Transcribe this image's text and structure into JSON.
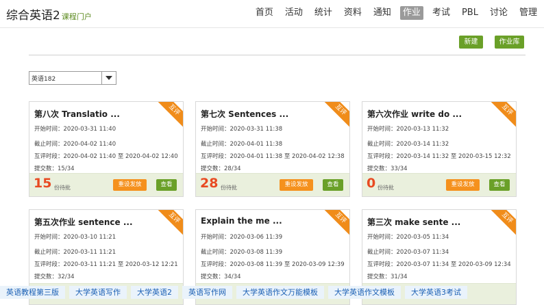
{
  "header": {
    "course_title": "综合英语2",
    "course_sub": "课程门户",
    "nav": [
      "首页",
      "活动",
      "统计",
      "资料",
      "通知",
      "作业",
      "考试",
      "PBL",
      "讨论",
      "管理"
    ],
    "active_nav": "作业"
  },
  "toolbar": {
    "new_label": "新建",
    "library_label": "作业库"
  },
  "class_select": {
    "value": "英语182"
  },
  "labels": {
    "start": "开始时间：",
    "deadline": "截止时间：",
    "peer_review": "互评时段：",
    "to": " 至 ",
    "submissions": "提交数：",
    "pending": "份待批",
    "reset_button": "重设发放",
    "view_button": "查看",
    "ribbon": "互评"
  },
  "assignments": [
    {
      "title": "第八次 Translatio ...",
      "start": "2020-03-31 11:40",
      "deadline": "2020-04-02 11:40",
      "peer_start": "2020-04-02 11:40",
      "peer_end": "2020-04-02 12:40",
      "submissions": "15/34",
      "pending": "15"
    },
    {
      "title": "第七次 Sentences ...",
      "start": "2020-03-31 11:38",
      "deadline": "2020-04-01 11:38",
      "peer_start": "2020-04-01 11:38",
      "peer_end": "2020-04-02 12:38",
      "submissions": "28/34",
      "pending": "28"
    },
    {
      "title": "第六次作业 write do ...",
      "start": "2020-03-13 11:32",
      "deadline": "2020-03-14 11:32",
      "peer_start": "2020-03-14 11:32",
      "peer_end": "2020-03-15 12:32",
      "submissions": "33/34",
      "pending": "0"
    },
    {
      "title": "第五次作业 sentence ...",
      "start": "2020-03-10 11:21",
      "deadline": "2020-03-11 11:21",
      "peer_start": "2020-03-11 11:21",
      "peer_end": "2020-03-12 12:21",
      "submissions": "32/34",
      "pending": ""
    },
    {
      "title": "Explain the me ...",
      "start": "2020-03-06 11:39",
      "deadline": "2020-03-08 11:39",
      "peer_start": "2020-03-08 11:39",
      "peer_end": "2020-03-09 12:39",
      "submissions": "34/34",
      "pending": ""
    },
    {
      "title": "第三次 make sente ...",
      "start": "2020-03-05 11:34",
      "deadline": "2020-03-07 11:34",
      "peer_start": "2020-03-07 11:34",
      "peer_end": "2020-03-09 12:34",
      "submissions": "31/34",
      "pending": ""
    }
  ],
  "footer_links": [
    "英语教程第三版",
    "大学英语写作",
    "大学英语2",
    "英语写作网",
    "大学英语作文万能模板",
    "大学英语作文模板",
    "大学英语3考试"
  ],
  "colors": {
    "accent_green": "#6aa028",
    "accent_orange": "#f5911d",
    "pending_red": "#e84a22"
  }
}
